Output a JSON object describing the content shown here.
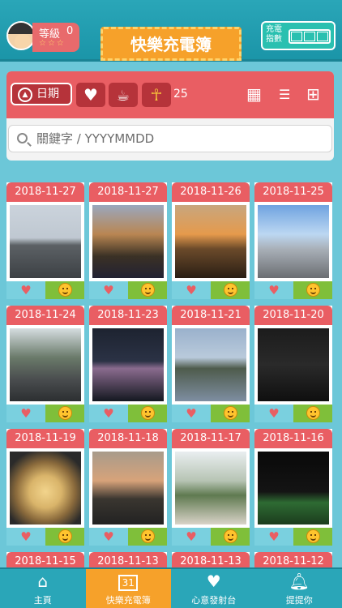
{
  "header": {
    "level_label": "等級",
    "level_value": "0",
    "stars": "☆☆☆",
    "title": "快樂充電簿",
    "charge_label": "充電指數"
  },
  "filter": {
    "date_label": "日期",
    "count": "25"
  },
  "search": {
    "placeholder": "關鍵字 / YYYYMMDD"
  },
  "cards": [
    {
      "date": "2018-11-27"
    },
    {
      "date": "2018-11-27"
    },
    {
      "date": "2018-11-26"
    },
    {
      "date": "2018-11-25"
    },
    {
      "date": "2018-11-24"
    },
    {
      "date": "2018-11-23"
    },
    {
      "date": "2018-11-21"
    },
    {
      "date": "2018-11-20"
    },
    {
      "date": "2018-11-19"
    },
    {
      "date": "2018-11-18"
    },
    {
      "date": "2018-11-17"
    },
    {
      "date": "2018-11-16"
    },
    {
      "date": "2018-11-15"
    },
    {
      "date": "2018-11-13"
    },
    {
      "date": "2018-11-13"
    },
    {
      "date": "2018-11-12"
    }
  ],
  "nav": {
    "home": "主頁",
    "diary": "快樂充電簿",
    "diary_icon": "31",
    "wish": "心意發射台",
    "remind": "提提你"
  }
}
